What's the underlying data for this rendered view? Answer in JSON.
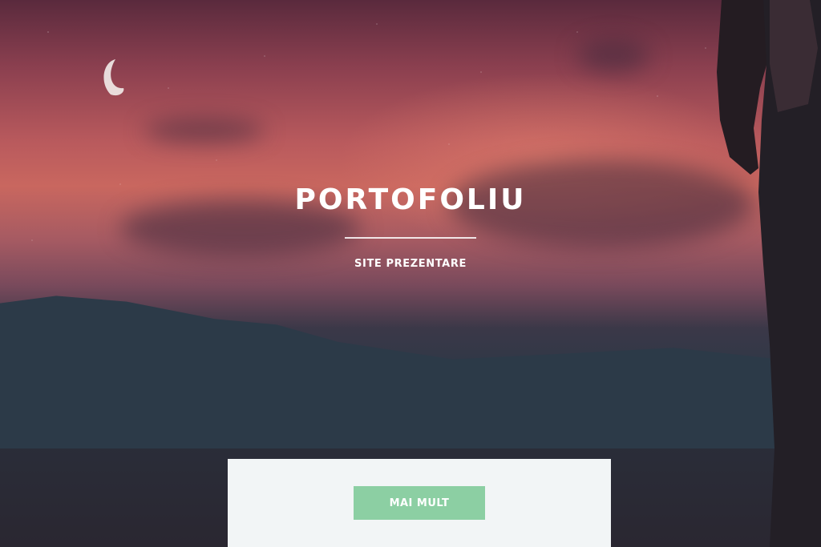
{
  "hero": {
    "title": "PORTOFOLIU",
    "subtitle": "SITE PREZENTARE",
    "cta_label": "MAI MULT"
  },
  "colors": {
    "cta_background": "#8ccfa3",
    "panel_background": "#f2f5f6",
    "text": "#ffffff"
  },
  "icons": {
    "moon": "crescent-moon"
  }
}
